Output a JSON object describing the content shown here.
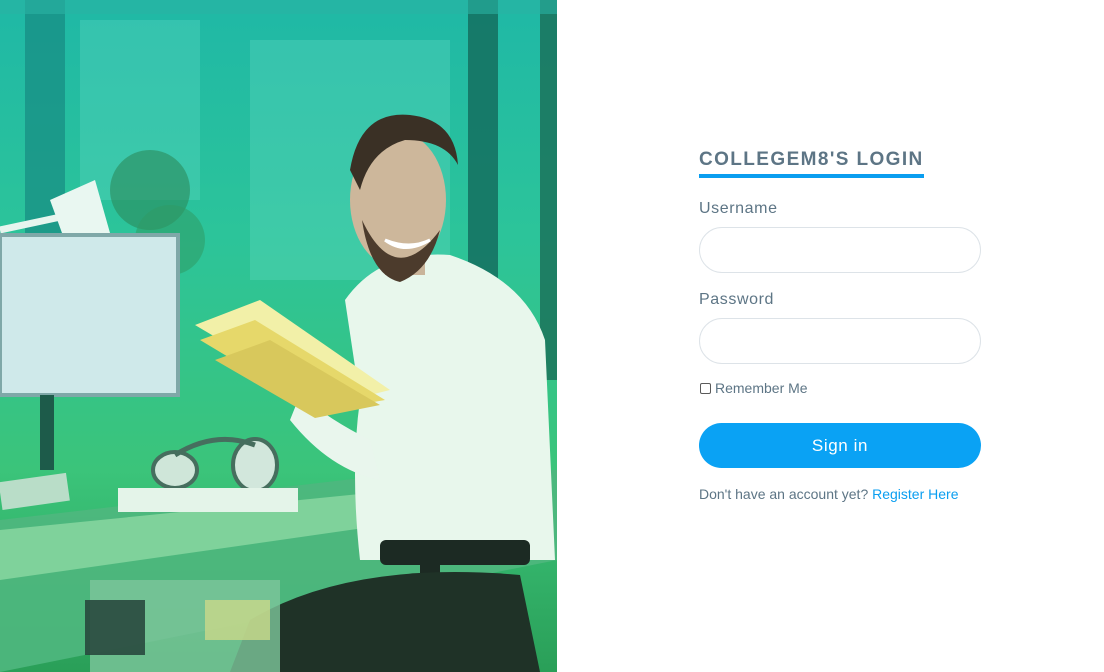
{
  "hero": {
    "image_description_icon": "person-reading-book-illustration",
    "overlay_color": "#2cc49a"
  },
  "login": {
    "title": "COLLEGEM8'S LOGIN",
    "username_label": "Username",
    "username_value": "",
    "password_label": "Password",
    "password_value": "",
    "remember_label": "Remember Me",
    "remember_checked": false,
    "signin_label": "Sign in",
    "register_prompt": "Don't have an account yet?",
    "register_link": "Register Here"
  },
  "colors": {
    "accent": "#0aa2f4",
    "text": "#5d7585",
    "link": "#0a9ef0"
  }
}
